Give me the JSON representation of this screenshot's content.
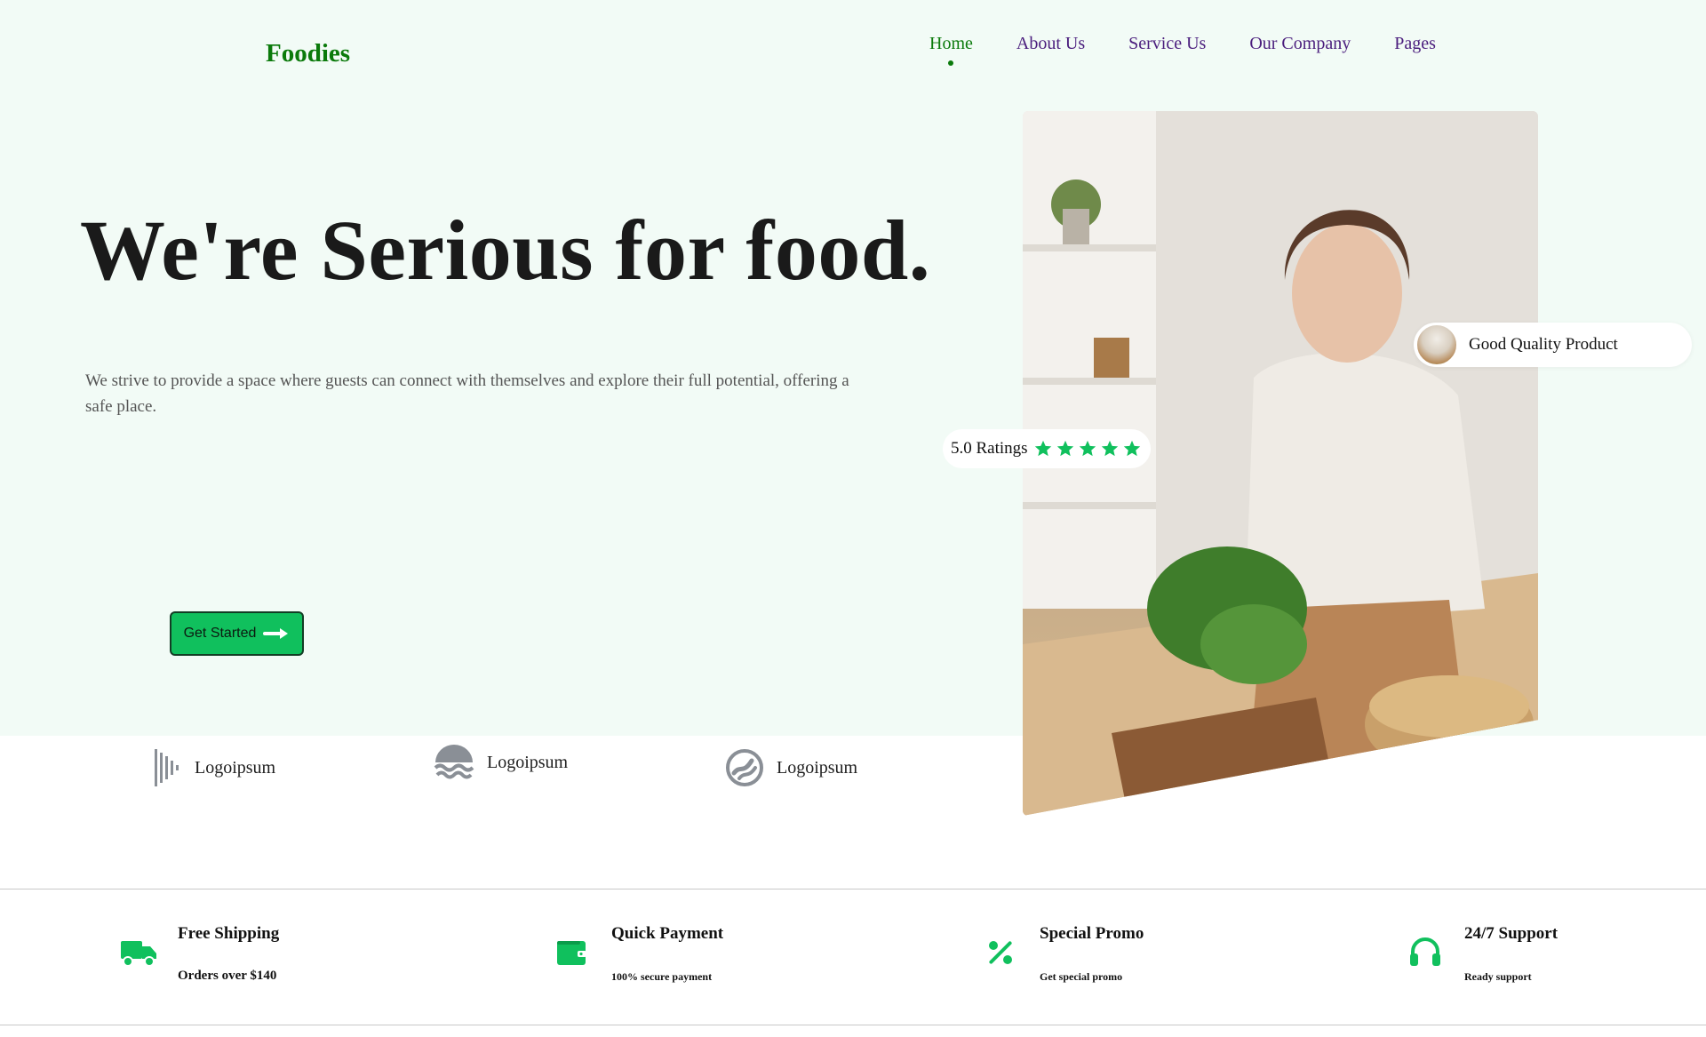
{
  "brand": "Foodies",
  "nav": [
    {
      "label": "Home",
      "active": true
    },
    {
      "label": "About Us"
    },
    {
      "label": "Service Us"
    },
    {
      "label": "Our Company"
    },
    {
      "label": "Pages"
    }
  ],
  "hero": {
    "title": "We're Serious for food.",
    "description": "We strive to provide a space where guests can connect with themselves and explore their full potential, offering a safe place.",
    "cta_label": "Get Started",
    "cta_icon": "arrow-right-icon"
  },
  "badges": {
    "quality": "Good Quality Product",
    "ratings": "5.0 Ratings",
    "stars": 5
  },
  "logos": [
    {
      "label": "Logoipsum",
      "icon": "bars-logo-icon"
    },
    {
      "label": "Logoipsum",
      "icon": "waves-logo-icon"
    },
    {
      "label": "Logoipsum",
      "icon": "stripe-circle-logo-icon"
    }
  ],
  "features": [
    {
      "title": "Free Shipping",
      "subtitle": "Orders over $140",
      "icon": "truck-icon"
    },
    {
      "title": "Quick Payment",
      "subtitle": "100% secure payment",
      "icon": "wallet-icon"
    },
    {
      "title": "Special Promo",
      "subtitle": "Get special promo",
      "icon": "percent-icon"
    },
    {
      "title": "24/7 Support",
      "subtitle": "Ready support",
      "icon": "headphones-icon"
    }
  ],
  "colors": {
    "brand": "#0b7a0b",
    "accent": "#10c05d",
    "nav": "#4a1d7d",
    "hero_bg": "#f2fbf6"
  }
}
